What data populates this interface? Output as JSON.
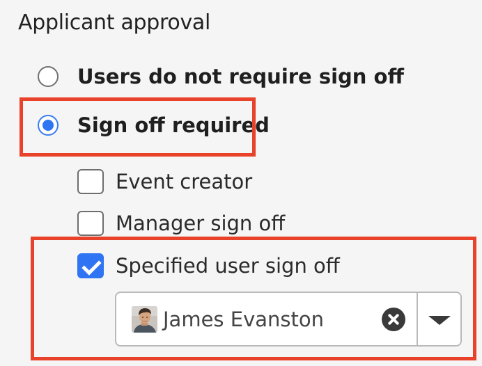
{
  "section": {
    "title": "Applicant approval"
  },
  "approval_options": [
    {
      "label": "Users do not require sign off",
      "selected": false
    },
    {
      "label": "Sign off required",
      "selected": true
    }
  ],
  "sign_off_options": [
    {
      "label": "Event creator",
      "checked": false
    },
    {
      "label": "Manager sign off",
      "checked": false
    },
    {
      "label": "Specified user sign off",
      "checked": true
    }
  ],
  "user_select": {
    "selected_user": "James Evanston",
    "avatar_icon": "user-avatar-photo",
    "clear_icon": "close-circle-icon",
    "dropdown_icon": "chevron-down-icon"
  },
  "colors": {
    "accent": "#2f74f2",
    "highlight": "#e8432a",
    "background": "#f5f5f5"
  }
}
